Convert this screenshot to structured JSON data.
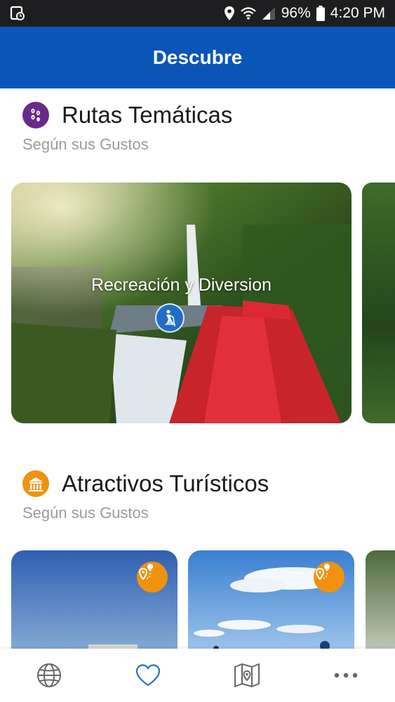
{
  "status_bar": {
    "battery": "96%",
    "time": "4:20 PM"
  },
  "app_bar": {
    "title": "Descubre"
  },
  "sections": {
    "routes": {
      "title": "Rutas Temáticas",
      "subtitle": "Según sus Gustos",
      "icon": "footprints-icon",
      "icon_color": "#6a2a8a",
      "cards": [
        {
          "label": "Recreación y Diversion",
          "badge_icon": "hiker-icon"
        }
      ]
    },
    "attractions": {
      "title": "Atractivos Turísticos",
      "subtitle": "Según sus Gustos",
      "icon": "building-icon",
      "icon_color": "#f0920f",
      "cards": [
        {
          "badge_icon": "map-pin-route-icon"
        },
        {
          "badge_icon": "map-pin-route-icon"
        }
      ]
    }
  },
  "bottom_nav": {
    "items": [
      {
        "icon": "globe-icon",
        "active": false
      },
      {
        "icon": "heart-icon",
        "active": true
      },
      {
        "icon": "map-icon",
        "active": false
      },
      {
        "icon": "more-icon",
        "active": false
      }
    ],
    "active_color": "#1f6fc6",
    "inactive_color": "#666666"
  }
}
